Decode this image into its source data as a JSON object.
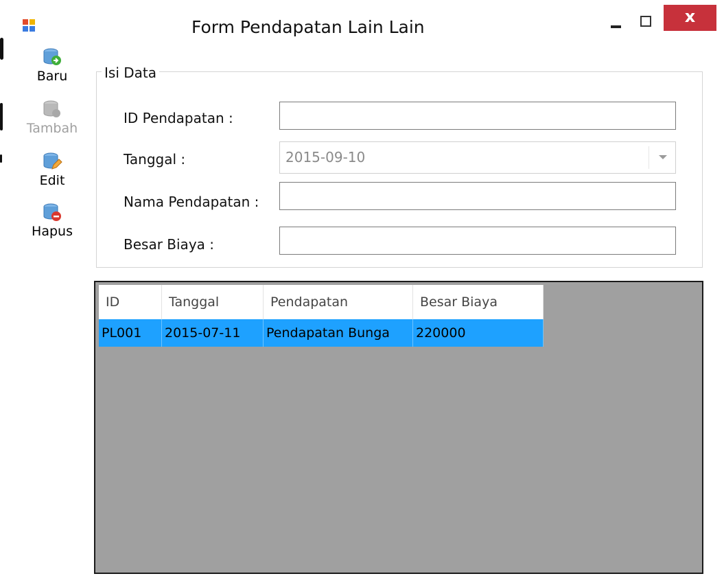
{
  "window": {
    "title": "Form Pendapatan Lain Lain",
    "close_label": "x"
  },
  "toolbar": {
    "items": [
      {
        "label": "Baru",
        "icon": "add-database-icon",
        "enabled": true
      },
      {
        "label": "Tambah",
        "icon": "save-database-icon",
        "enabled": false
      },
      {
        "label": "Edit",
        "icon": "edit-database-icon",
        "enabled": true
      },
      {
        "label": "Hapus",
        "icon": "delete-database-icon",
        "enabled": true
      }
    ]
  },
  "form": {
    "group_title": "Isi Data",
    "id_label": "ID Pendapatan :",
    "id_value": "",
    "date_label": "Tanggal :",
    "date_value": "2015-09-10",
    "name_label": "Nama Pendapatan :",
    "name_value": "",
    "cost_label": "Besar Biaya :",
    "cost_value": ""
  },
  "grid": {
    "columns": [
      "ID",
      "Tanggal",
      "Pendapatan",
      "Besar Biaya"
    ],
    "rows": [
      [
        "PL001",
        "2015-07-11",
        "Pendapatan Bunga",
        "220000"
      ]
    ],
    "selected_row": 0
  },
  "colors": {
    "selection": "#1ea1ff",
    "grid_background": "#a0a0a0",
    "close_button": "#c7313b"
  }
}
